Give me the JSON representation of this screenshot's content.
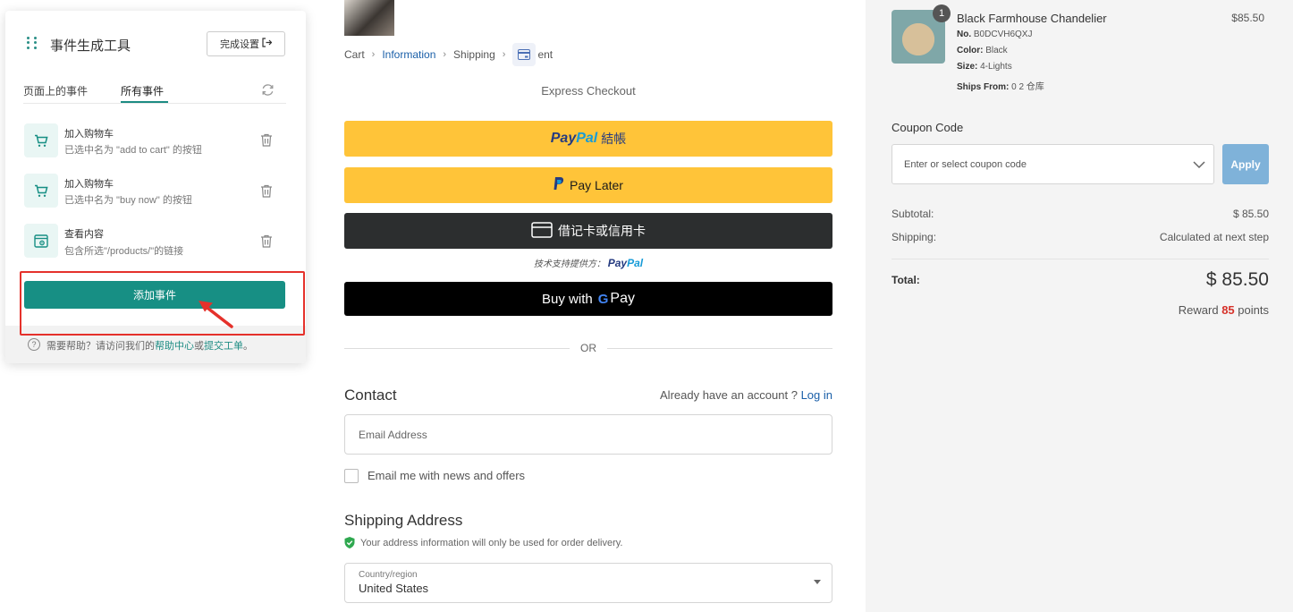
{
  "checkout": {
    "breadcrumb": {
      "cart": "Cart",
      "information": "Information",
      "shipping": "Shipping",
      "payment_partial": "ent"
    },
    "express_title": "Express Checkout",
    "paypal_btn": {
      "brand1": "Pay",
      "brand2": "Pal",
      "suffix": "結帳"
    },
    "paylater_btn": {
      "label": "Pay Later"
    },
    "card_btn": {
      "label": "借记卡或信用卡"
    },
    "powered_by": {
      "prefix": "技术支持提供方：",
      "brand1": "Pay",
      "brand2": "Pal"
    },
    "gpay_btn": {
      "prefix": "Buy with",
      "g": "G",
      "pay": "Pay"
    },
    "or_text": "OR",
    "contact": {
      "title": "Contact",
      "account_prompt": "Already have an account ?",
      "login_link": "Log in",
      "email_placeholder": "Email Address",
      "news_label": "Email me with news and offers"
    },
    "shipping": {
      "title": "Shipping Address",
      "note": "Your address information will only be used for order delivery.",
      "country_label": "Country/region",
      "country_value": "United States"
    }
  },
  "summary": {
    "product": {
      "qty": "1",
      "name": "Black Farmhouse Chandelier",
      "price": "$85.50",
      "meta": [
        {
          "label": "No.",
          "value": " B0DCVH6QXJ"
        },
        {
          "label": "Color:",
          "value": " Black"
        },
        {
          "label": "Size:",
          "value": " 4-Lights"
        },
        {
          "label": "Ships From:",
          "value": " 0 2 仓库"
        }
      ]
    },
    "coupon_title": "Coupon Code",
    "coupon_placeholder": "Enter or select coupon code",
    "apply_label": "Apply",
    "subtotal_label": "Subtotal:",
    "subtotal_value": "$ 85.50",
    "shipping_label": "Shipping:",
    "shipping_value": "Calculated at next step",
    "total_label": "Total:",
    "total_value": "$ 85.50",
    "reward_prefix": "Reward",
    "reward_points": "85",
    "reward_suffix": "points",
    "colors": {
      "apply": "#7fb2d9",
      "reward": "#d6322a"
    }
  },
  "event_tool": {
    "title": "事件生成工具",
    "done_label": "完成设置",
    "tabs": [
      "页面上的事件",
      "所有事件"
    ],
    "active_tab": 1,
    "events": [
      {
        "icon": "cart-icon",
        "title": "加入购物车",
        "desc": "已选中名为 \"add to cart\" 的按钮"
      },
      {
        "icon": "cart-icon",
        "title": "加入购物车",
        "desc": "已选中名为 \"buy now\" 的按钮"
      },
      {
        "icon": "view-content-icon",
        "title": "查看内容",
        "desc": "包含所选\"/products/\"的链接"
      }
    ],
    "add_event_label": "添加事件",
    "help": {
      "prefix": "需要帮助？请访问我们的",
      "help_center": "帮助中心",
      "or": "或",
      "ticket": "提交工单",
      "suffix": "。"
    },
    "colors": {
      "accent": "#178f84",
      "highlight": "#e5312b"
    }
  }
}
